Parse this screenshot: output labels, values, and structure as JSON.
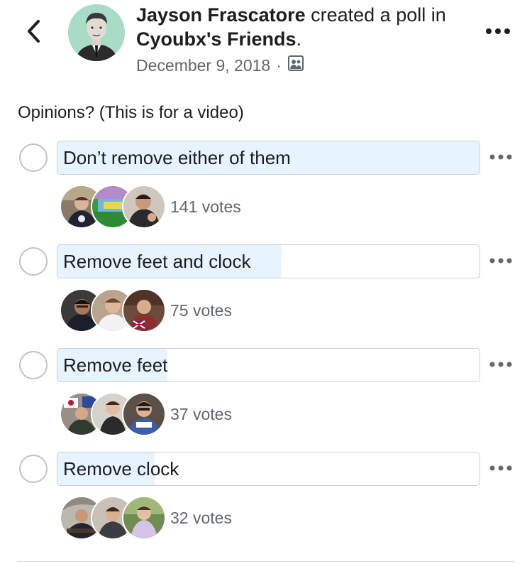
{
  "post": {
    "author_name": "Jayson Frascatore",
    "action_text": " created a poll in ",
    "group_name": "Cyoubx's Friends",
    "period": ".",
    "date": "December 9, 2018",
    "separator": "·",
    "audience_icon": "group-audience-icon",
    "more_icon": "more-horizontal-icon",
    "back_icon": "chevron-left-icon"
  },
  "poll": {
    "question": "Opinions? (This is for a video)",
    "bar_fill_color": "#e7f3ff",
    "options": [
      {
        "label": "Don’t remove either of them",
        "votes_text": "141 votes",
        "votes": 141,
        "fill_fraction": 1.0
      },
      {
        "label": "Remove feet and clock",
        "votes_text": "75 votes",
        "votes": 75,
        "fill_fraction": 0.53
      },
      {
        "label": "Remove feet",
        "votes_text": "37 votes",
        "votes": 37,
        "fill_fraction": 0.26
      },
      {
        "label": "Remove clock",
        "votes_text": "32 votes",
        "votes": 32,
        "fill_fraction": 0.23
      }
    ]
  }
}
